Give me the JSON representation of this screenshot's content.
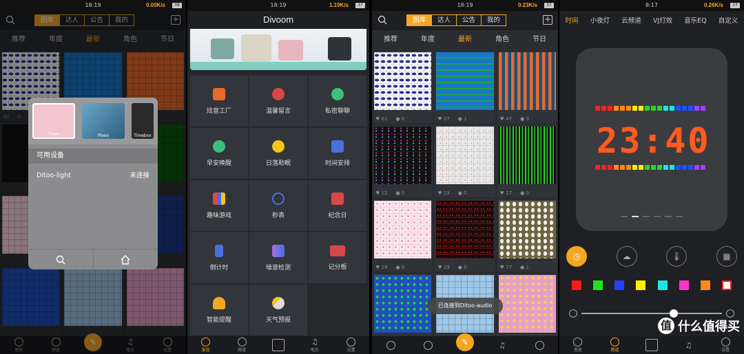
{
  "status": {
    "p1": {
      "time": "18:19",
      "speed": "0.00K/s",
      "battery": "38"
    },
    "p2": {
      "time": "18:19",
      "speed": "1.19K/s",
      "battery": "37"
    },
    "p3": {
      "time": "18:19",
      "speed": "0.23K/s",
      "battery": "37"
    },
    "p4": {
      "time": "8:17",
      "speed": "0.26K/s",
      "battery": "37"
    }
  },
  "gallery": {
    "segments": [
      "图库",
      "达人",
      "公告",
      "我的"
    ],
    "categories": [
      "推荐",
      "年度",
      "最新",
      "角色",
      "节日"
    ],
    "active_category": "最新"
  },
  "gallery_items": [
    {
      "likes": "61",
      "comments": "0"
    },
    {
      "likes": "37",
      "comments": "1"
    },
    {
      "likes": "47",
      "comments": "3"
    },
    {
      "likes": "12",
      "comments": "0"
    },
    {
      "likes": "19",
      "comments": "0"
    },
    {
      "likes": "17",
      "comments": "0"
    },
    {
      "likes": "29",
      "comments": "0"
    },
    {
      "likes": "29",
      "comments": "0"
    },
    {
      "likes": "77",
      "comments": "1"
    }
  ],
  "device_popup": {
    "devices": [
      "Tivoo",
      "Pixoo",
      "Timebox"
    ],
    "section_title": "可用设备",
    "device_name": "Ditoo-light",
    "device_status": "未连接"
  },
  "home": {
    "app_title": "Divoom",
    "tiles": [
      "炫音工厂",
      "温馨留言",
      "私密聊聊",
      "早安唤醒",
      "日落助眠",
      "时间安排",
      "趣味游戏",
      "秒表",
      "纪念日",
      "倒计时",
      "噪音检测",
      "记分板",
      "智能提醒",
      "天气预报"
    ]
  },
  "toast": "已连接到Ditoo-audio",
  "clock": {
    "tabs": [
      "时间",
      "小夜灯",
      "云频道",
      "VJ灯效",
      "音乐EQ",
      "自定义"
    ],
    "display_time": "23:40",
    "swatches": [
      "#ff1a1a",
      "#19e619",
      "#2040ff",
      "#ffee00",
      "#1ae6e6",
      "#ff33cc",
      "#ff8a1a",
      "#ffffff"
    ]
  },
  "nav": {
    "p1": [
      "发现",
      "频道",
      "",
      "电台",
      "设置"
    ],
    "p2": [
      "发现",
      "频道",
      "",
      "电台",
      "设置"
    ],
    "p4": [
      "发现",
      "频道",
      "",
      "",
      "设置"
    ]
  },
  "watermark": {
    "badge": "值",
    "text": "什么值得买"
  }
}
